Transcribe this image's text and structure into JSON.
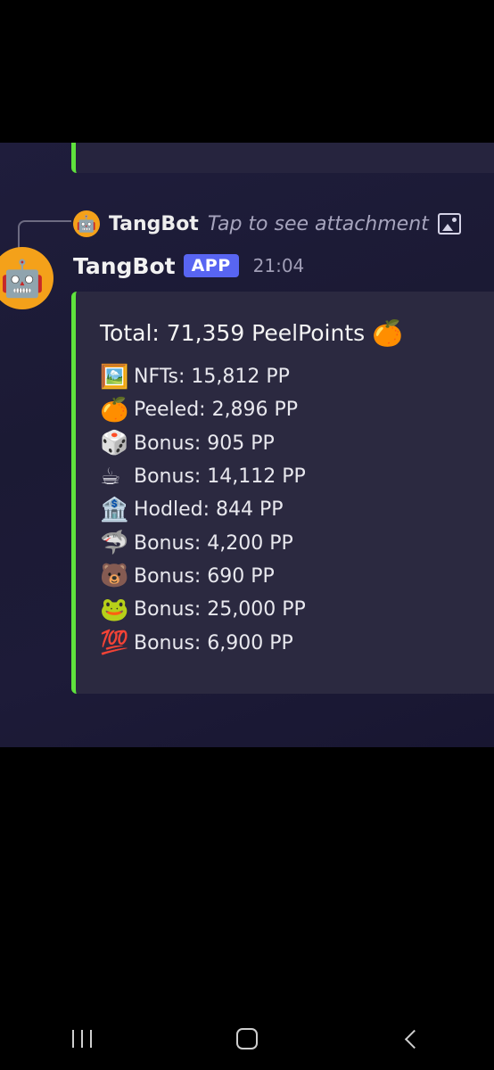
{
  "reply": {
    "avatar_emoji": "🤖",
    "name": "TangBot",
    "hint": "Tap to see attachment"
  },
  "message": {
    "avatar_emoji": "🤖",
    "author": "TangBot",
    "badge": "APP",
    "time": "21:04"
  },
  "embed": {
    "total": "Total: 71,359 PeelPoints",
    "total_emoji": "🍊",
    "lines": [
      {
        "emoji": "🖼️",
        "text": "NFTs: 15,812 PP"
      },
      {
        "emoji": "🍊",
        "text": "Peeled: 2,896 PP"
      },
      {
        "emoji": "🎲",
        "text": "Bonus: 905 PP"
      },
      {
        "emoji": "☕",
        "text": "Bonus: 14,112 PP"
      },
      {
        "emoji": "🏦",
        "text": "Hodled: 844 PP"
      },
      {
        "emoji": "🦈",
        "text": "Bonus: 4,200 PP"
      },
      {
        "emoji": "🐻",
        "text": "Bonus: 690 PP"
      },
      {
        "emoji": "🐸",
        "text": "Bonus: 25,000 PP"
      },
      {
        "emoji": "💯",
        "text": "Bonus: 6,900 PP"
      }
    ]
  },
  "colors": {
    "accent_bar": "#5fe23d",
    "badge": "#5865f2",
    "avatar_bg": "#f4a11a",
    "chat_bg": "#1e1c3a",
    "embed_bg": "#2b2940"
  },
  "navbar": {
    "recents_icon": "recents-icon",
    "home_icon": "home-icon",
    "back_icon": "back-icon"
  }
}
